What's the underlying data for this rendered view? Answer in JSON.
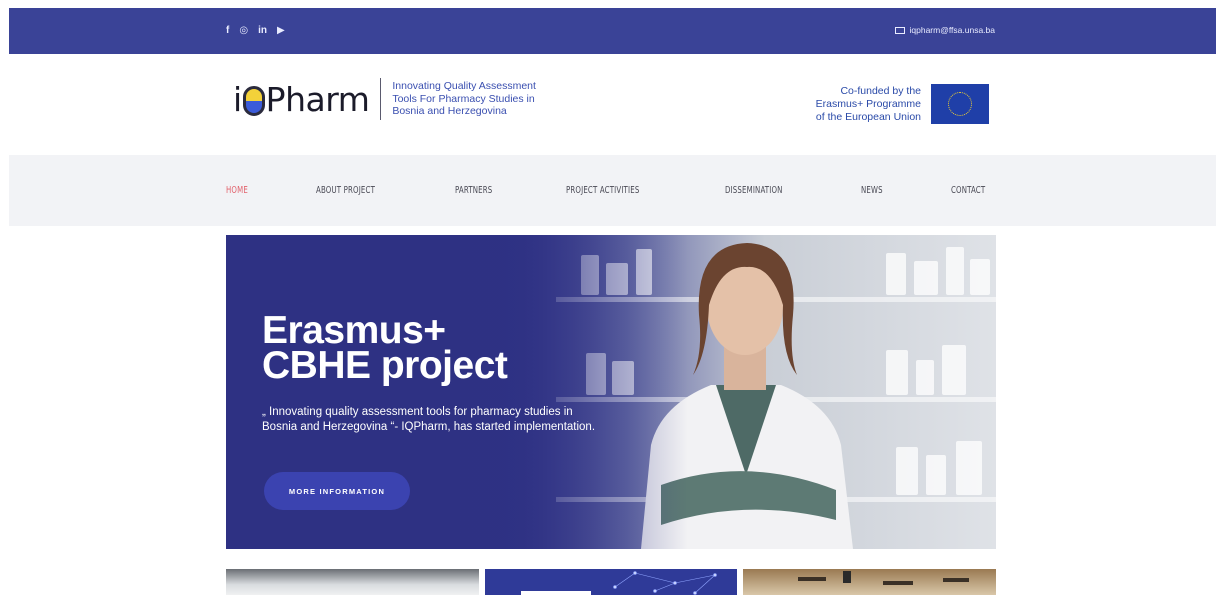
{
  "topbar": {
    "social": [
      {
        "name": "facebook-icon",
        "glyph": "f"
      },
      {
        "name": "instagram-icon",
        "glyph": "◎"
      },
      {
        "name": "linkedin-icon",
        "glyph": "in"
      },
      {
        "name": "youtube-icon",
        "glyph": "▶"
      }
    ],
    "email": "iqpharm@ffsa.unsa.ba"
  },
  "header": {
    "logo_text_left": "i",
    "logo_text_right": "Pharm",
    "tagline": [
      "Innovating Quality Assessment",
      "Tools For Pharmacy Studies in",
      "Bosnia and Herzegovina"
    ],
    "eu_text": [
      "Co-funded by the",
      "Erasmus+ Programme",
      "of the European Union"
    ]
  },
  "nav": {
    "items": [
      "HOME",
      "ABOUT PROJECT",
      "PARTNERS",
      "PROJECT ACTIVITIES",
      "DISSEMINATION",
      "NEWS",
      "CONTACT"
    ],
    "active": "HOME"
  },
  "hero": {
    "title_line1": "Erasmus+",
    "title_line2": "CBHE project",
    "text": "„ Innovating quality assessment tools for pharmacy studies in Bosnia and Herzegovina “- IQPharm, has started implementation.",
    "button": "MORE INFORMATION"
  },
  "colors": {
    "topbar": "#3a4397",
    "nav_bg": "#f2f3f6",
    "nav_active": "#e2636d",
    "hero_bg": "#2e3183",
    "button": "#3b43b0"
  }
}
